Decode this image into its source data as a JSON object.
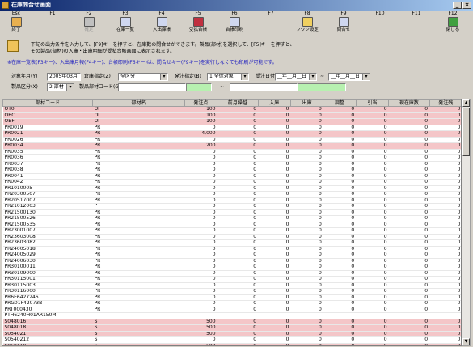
{
  "window": {
    "title": "在庫問合せ画面",
    "minimize": "_",
    "close": "×"
  },
  "fkeys": [
    {
      "key": "Esc",
      "label": "終了",
      "color": "#e8b050",
      "enabled": true
    },
    {
      "key": "F1",
      "label": "",
      "color": "#d4d0c8",
      "enabled": true
    },
    {
      "key": "F2",
      "label": "確定",
      "color": "#c0c0c0",
      "enabled": false
    },
    {
      "key": "F3",
      "label": "在庫一覧",
      "color": "#cfd7f0",
      "enabled": true
    },
    {
      "key": "F4",
      "label": "入出庫帳",
      "color": "#cfd7f0",
      "enabled": true
    },
    {
      "key": "F5",
      "label": "受払台帳",
      "color": "#c03040",
      "enabled": true
    },
    {
      "key": "F6",
      "label": "台帳印刷",
      "color": "#cfd7f0",
      "enabled": true
    },
    {
      "key": "F7",
      "label": "",
      "color": "#d4d0c8",
      "enabled": true
    },
    {
      "key": "F8",
      "label": "フワン設定",
      "color": "#f0d060",
      "enabled": true
    },
    {
      "key": "F9",
      "label": "問合せ",
      "color": "#cfd7f0",
      "enabled": true
    },
    {
      "key": "F10",
      "label": "",
      "color": "#d4d0c8",
      "enabled": true
    },
    {
      "key": "F11",
      "label": "",
      "color": "#d4d0c8",
      "enabled": true
    },
    {
      "key": "F12",
      "label": "閉じる",
      "color": "#40a040",
      "enabled": true
    }
  ],
  "message": {
    "line1": "下記の出力条件を入力して、[F9]キーを押すと、在庫数の問合せができます。製品(部材)を選択して、[F5]キーを押すと、",
    "line2": "その製品(部材)の入庫・出庫明細が受払台帳画面に表示されます。",
    "line3": "※在庫一覧表(F3キー)、入出庫月報(F4キー)、台帳印刷(F6キー)は、問合せキー(F9キー)を実行しなくても印刷が可能です。"
  },
  "form": {
    "month_label": "対象年月(Y)",
    "month_value": "2005年03月",
    "warehouse_label": "倉庫指定(Z)",
    "warehouse_value": "全区分",
    "order_label": "発注指定(B)",
    "order_value": "1 全体対象",
    "date_label": "受注日付",
    "date_from": "__年__月__日",
    "tilde": "~",
    "date_to": "__年__月__日",
    "category_label": "製品区分(X)",
    "category_value": "2 部材",
    "code_label": "製品部材コード(G)",
    "code_from": "",
    "code_to": ""
  },
  "table": {
    "headers": [
      "部材コード",
      "部材名",
      "発注点",
      "前月繰越",
      "入庫",
      "出庫",
      "調整",
      "引当",
      "現在庫数",
      "発注残"
    ],
    "rows": [
      {
        "code": "OT0F",
        "name": "OI",
        "c": [
          "100",
          "0",
          "0",
          "0",
          "0",
          "0",
          "0",
          "0"
        ],
        "hl": true
      },
      {
        "code": "OBC",
        "name": "OI",
        "c": [
          "100",
          "0",
          "0",
          "0",
          "0",
          "0",
          "0",
          "0"
        ],
        "hl": true
      },
      {
        "code": "OBF",
        "name": "OI",
        "c": [
          "100",
          "0",
          "0",
          "0",
          "0",
          "0",
          "0",
          "0"
        ],
        "hl": true
      },
      {
        "code": "PR0019",
        "name": "PR",
        "c": [
          "0",
          "0",
          "0",
          "0",
          "0",
          "0",
          "0",
          "0"
        ],
        "hl": false
      },
      {
        "code": "PR0021",
        "name": "PR",
        "c": [
          "4,000",
          "0",
          "0",
          "0",
          "0",
          "0",
          "0",
          "0"
        ],
        "hl": true
      },
      {
        "code": "PR0026",
        "name": "PR",
        "c": [
          "0",
          "0",
          "0",
          "0",
          "0",
          "0",
          "0",
          "0"
        ],
        "hl": false
      },
      {
        "code": "PR0034",
        "name": "PR",
        "c": [
          "200",
          "0",
          "0",
          "0",
          "0",
          "0",
          "0",
          "0"
        ],
        "hl": true
      },
      {
        "code": "PR0035",
        "name": "PR",
        "c": [
          "0",
          "0",
          "0",
          "0",
          "0",
          "0",
          "0",
          "0"
        ],
        "hl": false
      },
      {
        "code": "PR0036",
        "name": "PR",
        "c": [
          "0",
          "0",
          "0",
          "0",
          "0",
          "0",
          "0",
          "0"
        ],
        "hl": false
      },
      {
        "code": "PR0037",
        "name": "PR",
        "c": [
          "0",
          "0",
          "0",
          "0",
          "0",
          "0",
          "0",
          "0"
        ],
        "hl": false
      },
      {
        "code": "PR0038",
        "name": "PR",
        "c": [
          "0",
          "0",
          "0",
          "0",
          "0",
          "0",
          "0",
          "0"
        ],
        "hl": false
      },
      {
        "code": "PR0041",
        "name": "PR",
        "c": [
          "0",
          "0",
          "0",
          "0",
          "0",
          "0",
          "0",
          "0"
        ],
        "hl": false
      },
      {
        "code": "PR0042",
        "name": "PR",
        "c": [
          "0",
          "0",
          "0",
          "0",
          "0",
          "0",
          "0",
          "0"
        ],
        "hl": false
      },
      {
        "code": "PR1010005",
        "name": "PR",
        "c": [
          "0",
          "0",
          "0",
          "0",
          "0",
          "0",
          "0",
          "0"
        ],
        "hl": false
      },
      {
        "code": "PR20300507",
        "name": "PR",
        "c": [
          "0",
          "0",
          "0",
          "0",
          "0",
          "0",
          "0",
          "0"
        ],
        "hl": false
      },
      {
        "code": "PR20517007",
        "name": "PR",
        "c": [
          "0",
          "0",
          "0",
          "0",
          "0",
          "0",
          "0",
          "0"
        ],
        "hl": false
      },
      {
        "code": "PR21012003",
        "name": "P",
        "c": [
          "0",
          "0",
          "0",
          "0",
          "0",
          "0",
          "0",
          "0"
        ],
        "hl": false
      },
      {
        "code": "PR21500130",
        "name": "PR",
        "c": [
          "0",
          "0",
          "0",
          "0",
          "0",
          "0",
          "0",
          "0"
        ],
        "hl": false
      },
      {
        "code": "PR21500526",
        "name": "PR",
        "c": [
          "0",
          "0",
          "0",
          "0",
          "0",
          "0",
          "0",
          "0"
        ],
        "hl": false
      },
      {
        "code": "PR21500535",
        "name": "PR",
        "c": [
          "0",
          "0",
          "0",
          "0",
          "0",
          "0",
          "0",
          "0"
        ],
        "hl": false
      },
      {
        "code": "PR23001007",
        "name": "PR",
        "c": [
          "0",
          "0",
          "0",
          "0",
          "0",
          "0",
          "0",
          "0"
        ],
        "hl": false
      },
      {
        "code": "PR23603008",
        "name": "PR",
        "c": [
          "0",
          "0",
          "0",
          "0",
          "0",
          "0",
          "0",
          "0"
        ],
        "hl": false
      },
      {
        "code": "PR23603082",
        "name": "PR",
        "c": [
          "0",
          "0",
          "0",
          "0",
          "0",
          "0",
          "0",
          "0"
        ],
        "hl": false
      },
      {
        "code": "PR24005018",
        "name": "PR",
        "c": [
          "0",
          "0",
          "0",
          "0",
          "0",
          "0",
          "0",
          "0"
        ],
        "hl": false
      },
      {
        "code": "PR24005029",
        "name": "PR",
        "c": [
          "0",
          "0",
          "0",
          "0",
          "0",
          "0",
          "0",
          "0"
        ],
        "hl": false
      },
      {
        "code": "PR24006030",
        "name": "PR",
        "c": [
          "0",
          "0",
          "0",
          "0",
          "0",
          "0",
          "0",
          "0"
        ],
        "hl": false
      },
      {
        "code": "PR30100011",
        "name": "PR",
        "c": [
          "0",
          "0",
          "0",
          "0",
          "0",
          "0",
          "0",
          "0"
        ],
        "hl": false
      },
      {
        "code": "PR30109000",
        "name": "PR",
        "c": [
          "0",
          "0",
          "0",
          "0",
          "0",
          "0",
          "0",
          "0"
        ],
        "hl": false
      },
      {
        "code": "PR30115001",
        "name": "PR",
        "c": [
          "0",
          "0",
          "0",
          "0",
          "0",
          "0",
          "0",
          "0"
        ],
        "hl": false
      },
      {
        "code": "PR30115003",
        "name": "PR",
        "c": [
          "0",
          "0",
          "0",
          "0",
          "0",
          "0",
          "0",
          "0"
        ],
        "hl": false
      },
      {
        "code": "PR30116000",
        "name": "PR",
        "c": [
          "0",
          "0",
          "0",
          "0",
          "0",
          "0",
          "0",
          "0"
        ],
        "hl": false
      },
      {
        "code": "PR6E6427246",
        "name": "PR",
        "c": [
          "0",
          "0",
          "0",
          "0",
          "0",
          "0",
          "0",
          "0"
        ],
        "hl": false
      },
      {
        "code": "PRG01F42073B",
        "name": "PR",
        "c": [
          "0",
          "0",
          "0",
          "0",
          "0",
          "0",
          "0",
          "0"
        ],
        "hl": false
      },
      {
        "code": "PRT000430",
        "name": "PR",
        "c": [
          "0",
          "0",
          "0",
          "0",
          "0",
          "0",
          "0",
          "0"
        ],
        "hl": false
      },
      {
        "code": "PTH6240H01AR150M",
        "name": "",
        "c": [
          "",
          "",
          "",
          "",
          "",
          "",
          "",
          ""
        ],
        "hl": false
      },
      {
        "code": "S048016",
        "name": "S",
        "c": [
          "500",
          "0",
          "0",
          "0",
          "0",
          "0",
          "0",
          "0"
        ],
        "hl": true
      },
      {
        "code": "S048018",
        "name": "S",
        "c": [
          "500",
          "0",
          "0",
          "0",
          "0",
          "0",
          "0",
          "0"
        ],
        "hl": true
      },
      {
        "code": "S054021",
        "name": "S",
        "c": [
          "500",
          "0",
          "0",
          "0",
          "0",
          "0",
          "0",
          "0"
        ],
        "hl": true
      },
      {
        "code": "S0540212",
        "name": "S",
        "c": [
          "0",
          "0",
          "0",
          "0",
          "0",
          "0",
          "0",
          "0"
        ],
        "hl": false
      },
      {
        "code": "S060110",
        "name": "S",
        "c": [
          "500",
          "0",
          "0",
          "0",
          "0",
          "0",
          "0",
          "0"
        ],
        "hl": true
      }
    ]
  },
  "scrollbar": {
    "up": "▲",
    "down": "▼"
  },
  "colors": {
    "highlight": "#f4c6c8",
    "accent_green": "#b7f0b0",
    "title_bar": "#0a246a"
  }
}
